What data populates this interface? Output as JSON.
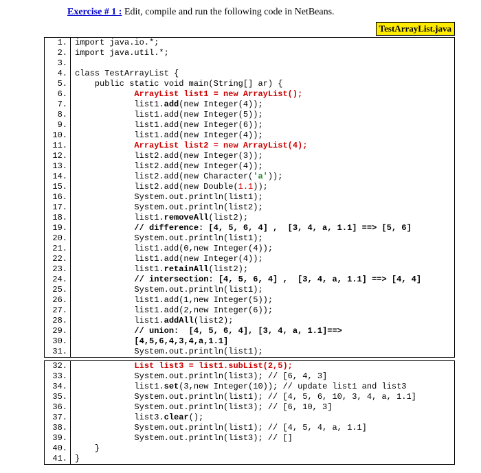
{
  "header": {
    "title": "Exercise # 1 :",
    "subtitle": " Edit, compile and run the following code in NetBeans."
  },
  "filename": "TestArrayList.java",
  "lines1": [
    {
      "n": "1.",
      "plain": "import java.io.*;"
    },
    {
      "n": "2.",
      "plain": "import java.util.*;"
    },
    {
      "n": "3.",
      "plain": ""
    },
    {
      "n": "4.",
      "plain": "class TestArrayList {"
    },
    {
      "n": "5.",
      "plain": "    public static void main(String[] ar) {"
    },
    {
      "n": "6.",
      "pre": "            ",
      "red": "ArrayList list1 = new ArrayList();"
    },
    {
      "n": "7.",
      "pre": "            list1.",
      "bold": "add",
      "post": "(new Integer(4));"
    },
    {
      "n": "8.",
      "plain": "            list1.add(new Integer(5));"
    },
    {
      "n": "9.",
      "plain": "            list1.add(new Integer(6));"
    },
    {
      "n": "10.",
      "plain": "            list1.add(new Integer(4));"
    },
    {
      "n": "11.",
      "pre": "            ",
      "red": "ArrayList list2 = new ArrayList(4);"
    },
    {
      "n": "12.",
      "plain": "            list2.add(new Integer(3));"
    },
    {
      "n": "13.",
      "plain": "            list2.add(new Integer(4));"
    },
    {
      "n": "14.",
      "pre": "            list2.add(new Character(",
      "green": "'a'",
      "post": "));"
    },
    {
      "n": "15.",
      "pre": "            list2.add(new Double(",
      "num": "1.1",
      "post": "));"
    },
    {
      "n": "16.",
      "plain": "            System.out.println(list1);"
    },
    {
      "n": "17.",
      "plain": "            System.out.println(list2);"
    },
    {
      "n": "18.",
      "pre": "            list1.",
      "bold": "removeAll",
      "post": "(list2);"
    },
    {
      "n": "19.",
      "boldline": "            // difference: [4, 5, 6, 4] ,  [3, 4, a, 1.1] ==> [5, 6]"
    },
    {
      "n": "20.",
      "plain": "            System.out.println(list1);"
    },
    {
      "n": "21.",
      "plain": "            list1.add(0,new Integer(4));"
    },
    {
      "n": "22.",
      "plain": "            list1.add(new Integer(4));"
    },
    {
      "n": "23.",
      "pre": "            list1.",
      "bold": "retainAll",
      "post": "(list2);"
    },
    {
      "n": "24.",
      "boldline": "            // intersection: [4, 5, 6, 4] ,  [3, 4, a, 1.1] ==> [4, 4]"
    },
    {
      "n": "25.",
      "plain": "            System.out.println(list1);"
    },
    {
      "n": "26.",
      "plain": "            list1.add(1,new Integer(5));"
    },
    {
      "n": "27.",
      "plain": "            list1.add(2,new Integer(6));"
    },
    {
      "n": "28.",
      "pre": "            list1.",
      "bold": "addAll",
      "post": "(list2);"
    },
    {
      "n": "29.",
      "boldline": "            // union:  [4, 5, 6, 4], [3, 4, a, 1.1]==>"
    },
    {
      "n": "30.",
      "boldline": "            [4,5,6,4,3,4,a,1.1]"
    },
    {
      "n": "31.",
      "plain": "            System.out.println(list1);"
    }
  ],
  "lines2": [
    {
      "n": "32.",
      "pre": "            ",
      "red": "List list3 = list1.subList(2,5);"
    },
    {
      "n": "33.",
      "plain": "            System.out.println(list3); // [6, 4, 3]"
    },
    {
      "n": "34.",
      "pre": "            list1.",
      "bold": "set",
      "post": "(3,new Integer(10)); // update list1 and list3"
    },
    {
      "n": "35.",
      "plain": "            System.out.println(list1); // [4, 5, 6, 10, 3, 4, a, 1.1]"
    },
    {
      "n": "36.",
      "plain": "            System.out.println(list3); // [6, 10, 3]"
    },
    {
      "n": "37.",
      "pre": "            list3.",
      "bold": "clear",
      "post": "();"
    },
    {
      "n": "38.",
      "plain": "            System.out.println(list1); // [4, 5, 4, a, 1.1]"
    },
    {
      "n": "39.",
      "plain": "            System.out.println(list3); // []"
    },
    {
      "n": "40.",
      "plain": "    }"
    },
    {
      "n": "41.",
      "plain": "}"
    }
  ]
}
